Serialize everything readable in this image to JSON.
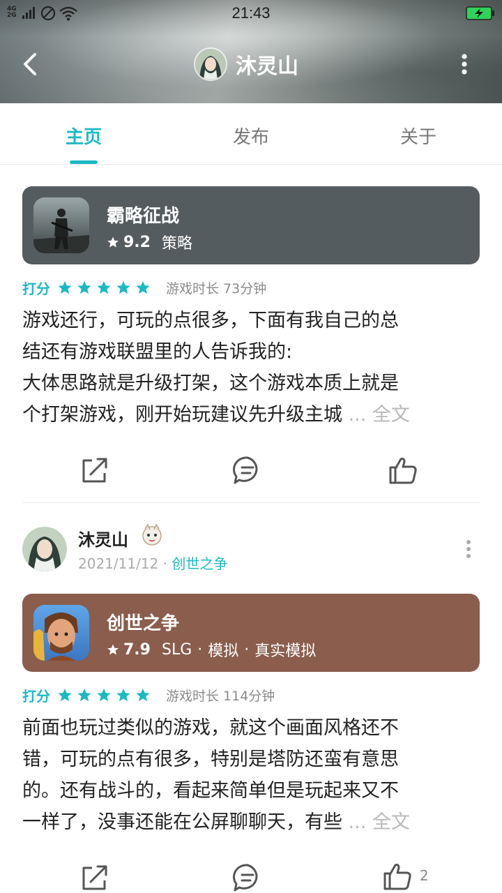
{
  "status_bar": {
    "network_top": "4G",
    "network_bottom": "2G",
    "time": "21:43"
  },
  "header": {
    "title": "沐灵山"
  },
  "tabs": [
    {
      "label": "主页",
      "active": true
    },
    {
      "label": "发布",
      "active": false
    },
    {
      "label": "关于",
      "active": false
    }
  ],
  "colors": {
    "accent": "#1cb9c5",
    "card1_bg": "#555c5f",
    "card2_bg": "#8a5d4d"
  },
  "posts": [
    {
      "game": {
        "name": "霸略征战",
        "score": "9.2",
        "tags": [
          "策略"
        ]
      },
      "rating_label": "打分",
      "stars": 5,
      "playtime": "游戏时长 73分钟",
      "review_lines": [
        "游戏还行，可玩的点很多，下面有我自己的总",
        "结还有游戏联盟里的人告诉我的:",
        "大体思路就是升级打架，这个游戏本质上就是",
        "个打架游戏，刚开始玩建议先升级主城"
      ],
      "read_more": "... 全文",
      "like_count": ""
    },
    {
      "author": "沐灵山",
      "date": "2021/11/12",
      "separator": "·",
      "game_link": "创世之争",
      "game": {
        "name": "创世之争",
        "score": "7.9",
        "tags": [
          "SLG",
          "模拟",
          "真实模拟"
        ]
      },
      "rating_label": "打分",
      "stars": 5,
      "playtime": "游戏时长 114分钟",
      "review_lines": [
        "前面也玩过类似的游戏，就这个画面风格还不",
        "错，可玩的点有很多，特别是塔防还蛮有意思",
        "的。还有战斗的，看起来简单但是玩起来又不",
        "一样了，没事还能在公屏聊聊天，有些"
      ],
      "read_more": "... 全文",
      "like_count": "2"
    }
  ]
}
